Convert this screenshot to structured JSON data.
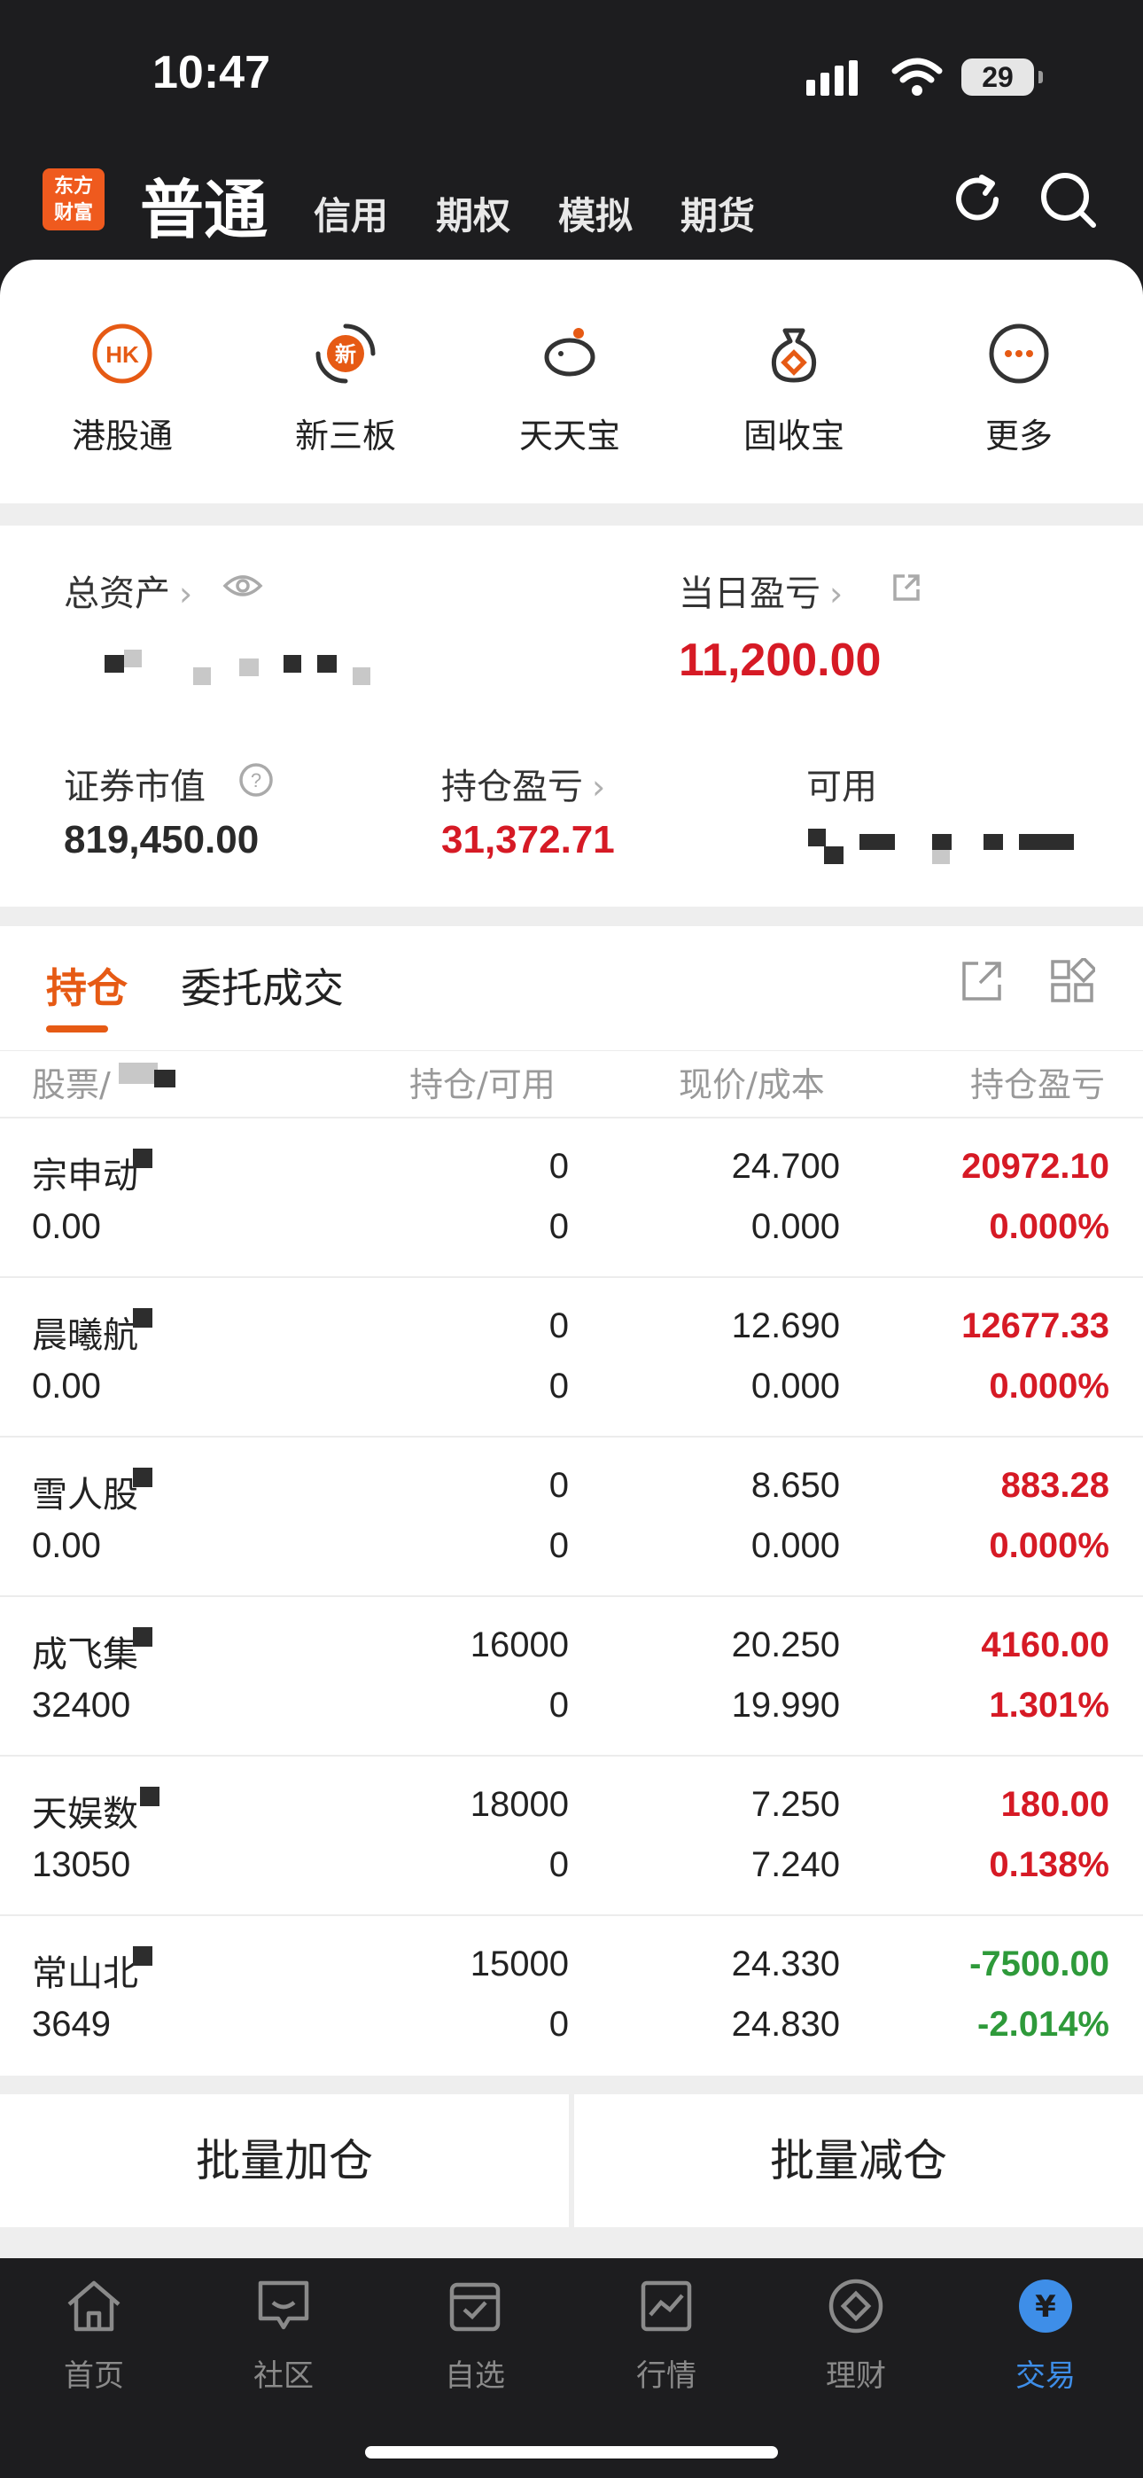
{
  "status_bar": {
    "time": "10:47",
    "battery": "29"
  },
  "top_nav": {
    "logo_line1": "东方",
    "logo_line2": "财富",
    "main": "普通",
    "tabs": [
      "信用",
      "期权",
      "模拟",
      "期货"
    ]
  },
  "quick_actions": [
    {
      "label": "港股通",
      "icon": "hk-icon"
    },
    {
      "label": "新三板",
      "icon": "new-board-icon"
    },
    {
      "label": "天天宝",
      "icon": "piggy-bank-icon"
    },
    {
      "label": "固收宝",
      "icon": "money-bag-icon"
    },
    {
      "label": "更多",
      "icon": "more-icon"
    }
  ],
  "assets": {
    "total_label": "总资产",
    "daily_pl_label": "当日盈亏",
    "daily_pl_value": "11,200.00",
    "market_value_label": "证券市值",
    "market_value": "819,450.00",
    "holding_pl_label": "持仓盈亏",
    "holding_pl_value": "31,372.71",
    "available_label": "可用"
  },
  "positions": {
    "tab_active": "持仓",
    "tab_other": "委托成交",
    "headers": {
      "stock": "股票/",
      "hold": "持仓/可用",
      "price": "现价/成本",
      "pl": "持仓盈亏"
    },
    "rows": [
      {
        "name": "宗申动",
        "value": "0.00",
        "hold": "0",
        "avail": "0",
        "price": "24.700",
        "cost": "0.000",
        "pl": "20972.10",
        "pl_pct": "0.000%",
        "dir": "pos"
      },
      {
        "name": "晨曦航",
        "value": "0.00",
        "hold": "0",
        "avail": "0",
        "price": "12.690",
        "cost": "0.000",
        "pl": "12677.33",
        "pl_pct": "0.000%",
        "dir": "pos"
      },
      {
        "name": "雪人股",
        "value": "0.00",
        "hold": "0",
        "avail": "0",
        "price": "8.650",
        "cost": "0.000",
        "pl": "883.28",
        "pl_pct": "0.000%",
        "dir": "pos"
      },
      {
        "name": "成飞集",
        "value": "32400",
        "hold": "16000",
        "avail": "0",
        "price": "20.250",
        "cost": "19.990",
        "pl": "4160.00",
        "pl_pct": "1.301%",
        "dir": "pos"
      },
      {
        "name": "天娱数",
        "value": "13050",
        "hold": "18000",
        "avail": "0",
        "price": "7.250",
        "cost": "7.240",
        "pl": "180.00",
        "pl_pct": "0.138%",
        "dir": "pos"
      },
      {
        "name": "常山北",
        "value": "3649",
        "hold": "15000",
        "avail": "0",
        "price": "24.330",
        "cost": "24.830",
        "pl": "-7500.00",
        "pl_pct": "-2.014%",
        "dir": "neg"
      }
    ]
  },
  "batch": {
    "add": "批量加仓",
    "reduce": "批量减仓"
  },
  "tabbar": [
    {
      "label": "首页",
      "icon": "home-icon"
    },
    {
      "label": "社区",
      "icon": "community-icon"
    },
    {
      "label": "自选",
      "icon": "watchlist-icon"
    },
    {
      "label": "行情",
      "icon": "market-icon"
    },
    {
      "label": "理财",
      "icon": "finance-icon"
    },
    {
      "label": "交易",
      "icon": "trade-icon"
    }
  ],
  "colors": {
    "accent_orange": "#e65a14",
    "up_red": "#d61a25",
    "down_green": "#2e9a3a",
    "tab_active_blue": "#3e8ee8"
  }
}
